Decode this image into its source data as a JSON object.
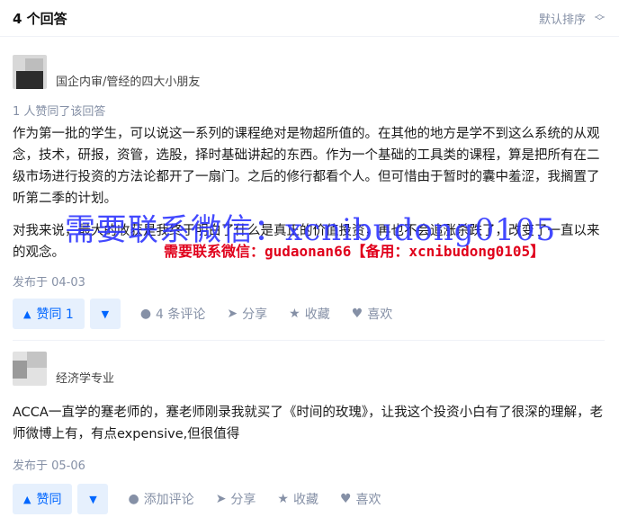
{
  "header": {
    "title": "4 个回答",
    "sort_label": "默认排序"
  },
  "answers": [
    {
      "author_desc": "国企内审/管经的四大小朋友",
      "likes_text": "1 人赞同了该回答",
      "paragraphs": [
        "作为第一批的学生，可以说这一系列的课程绝对是物超所值的。在其他的地方是学不到这么系统的从观念，技术，研报，资管，选股，择时基础讲起的东西。作为一个基础的工具类的课程，算是把所有在二级市场进行投资的方法论都开了一扇门。之后的修行都看个人。但可惜由于暂时的囊中羞涩，我搁置了听第二季的计划。",
        "对我来说，最大的收获是我终于明白了什么是真正的价值投资，再也不会追涨杀跌了，改变了一直以来的观念。"
      ],
      "date": "发布于 04-03",
      "vote_label": "赞同 1",
      "comment_label": "4 条评论",
      "share_label": "分享",
      "fav_label": "收藏",
      "like_label": "喜欢"
    },
    {
      "author_desc": "经济学专业",
      "paragraphs": [
        "ACCA一直学的蹇老师的，蹇老师刚录我就买了《时间的玫瑰》，让我这个投资小白有了很深的理解，老师微博上有，有点expensive,但很值得"
      ],
      "date": "发布于 05-06",
      "vote_label": "赞同",
      "comment_label": "添加评论",
      "share_label": "分享",
      "fav_label": "收藏",
      "like_label": "喜欢"
    }
  ],
  "watermark": {
    "big": "需要联系微信：xcnibudong0105",
    "red": "需要联系微信：gudaonan66【备用：xcnibudong0105】"
  },
  "colors": {
    "accent": "#0066ff",
    "vote_bg": "#e6f0fd",
    "muted": "#8590a6",
    "watermark_blue": "#2f36ff",
    "watermark_red": "#e0001b"
  },
  "icons": [
    "sort-chevron-icon",
    "vote-up-icon",
    "vote-down-icon",
    "comment-icon",
    "share-icon",
    "star-icon",
    "heart-icon"
  ]
}
